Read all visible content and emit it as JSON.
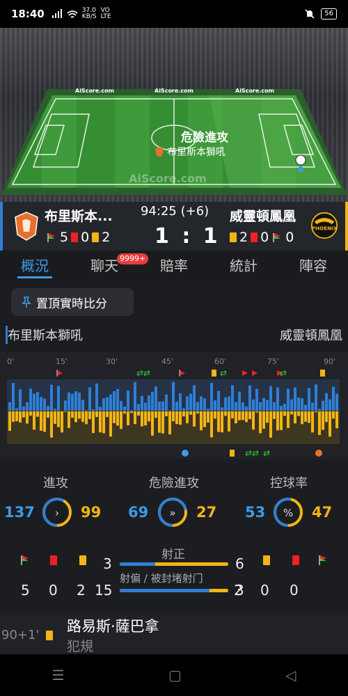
{
  "status_bar": {
    "time": "18:40",
    "net_speed_value": "37.0",
    "net_speed_unit": "KB/S",
    "vo": "VO",
    "lte": "LTE",
    "battery": "56"
  },
  "pitch": {
    "event": "危險進攻",
    "event_team": "布里斯本獅吼",
    "watermark": "AiScore.com",
    "ad": "AiScore.com"
  },
  "match": {
    "home_name": "布里斯本...",
    "away_name": "威靈頓鳳凰",
    "time": "94:25 (+6)",
    "score": "1 : 1",
    "home_stats": {
      "corners": "5",
      "red": "0",
      "yellow": "2"
    },
    "away_stats": {
      "yellow": "2",
      "red": "0",
      "corners": "0"
    },
    "away_logo_text": "PHOENIX"
  },
  "tabs": [
    "概況",
    "聊天",
    "賠率",
    "統計",
    "陣容"
  ],
  "chat_badge": "9999+",
  "pin_button": "置頂實時比分",
  "side_home": "布里斯本獅吼",
  "side_away": "威靈頓鳳凰",
  "timeline": {
    "ticks": [
      "0'",
      "15'",
      "30'",
      "45'",
      "60'",
      "75'",
      "90'"
    ]
  },
  "stats": {
    "attack": {
      "label": "進攻",
      "home": "137",
      "away": "99",
      "home_share": 0.58
    },
    "danger": {
      "label": "危險進攻",
      "home": "69",
      "away": "27",
      "home_share": 0.72
    },
    "possession": {
      "label": "控球率",
      "home": "53",
      "away": "47",
      "home_share": 0.53
    },
    "home_corners": "5",
    "home_red": "0",
    "home_yellow": "2",
    "away_corners": "0",
    "away_red": "0",
    "away_yellow": "2",
    "shots_on_label": "射正",
    "shots_on_home": "3",
    "shots_on_away": "6",
    "shots_on_home_share": 0.33,
    "shots_off_label": "射偏 / 被封堵射门",
    "shots_off_home": "15",
    "shots_off_away": "3",
    "shots_off_home_share": 0.83
  },
  "event": {
    "minute": "90+1'",
    "player": "路易斯·薩巴拿",
    "reason": "犯規"
  },
  "nav": {
    "menu": "☰",
    "home": "▢",
    "back": "◁"
  },
  "colors": {
    "home": "#2f7fd6",
    "away": "#f3b514",
    "pitch": "#3e9a3a"
  }
}
